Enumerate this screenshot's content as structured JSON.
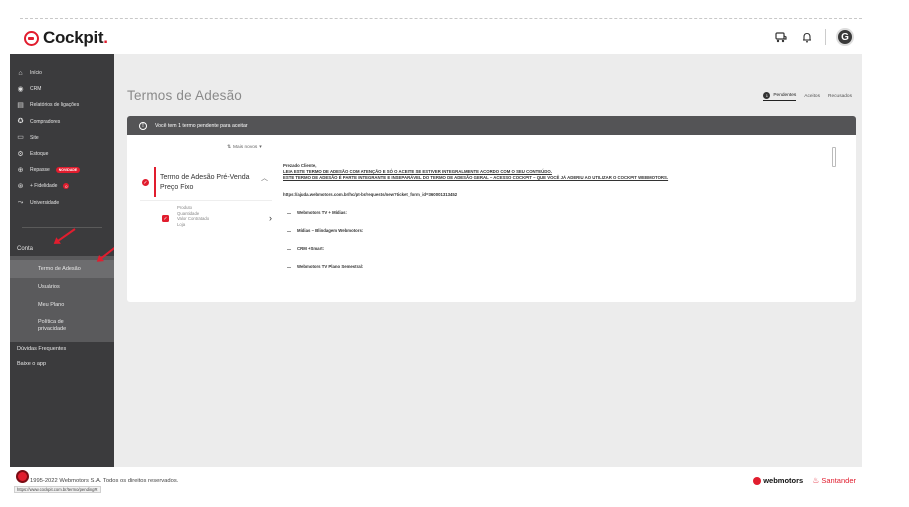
{
  "app": {
    "brand_name": "Cockpit",
    "brand_suffix": ".",
    "avatar_initial": "G"
  },
  "sidebar": {
    "items": [
      {
        "label": "Início",
        "icon": "home-icon"
      },
      {
        "label": "CRM",
        "icon": "crm-icon"
      },
      {
        "label": "Relatórios de ligações",
        "icon": "report-icon"
      },
      {
        "label": "Compradores",
        "icon": "buyers-icon"
      },
      {
        "label": "Site",
        "icon": "site-icon"
      },
      {
        "label": "Estoque",
        "icon": "stock-icon"
      },
      {
        "label": "Repasse",
        "icon": "repasse-icon",
        "badge": "NOVIDADE"
      },
      {
        "label": "+ Fidelidade",
        "icon": "loyalty-icon",
        "badge": "0"
      },
      {
        "label": "Universidade",
        "icon": "university-icon"
      }
    ],
    "conta_label": "Conta",
    "conta_items": [
      {
        "label": "Termo de Adesão"
      },
      {
        "label": "Usuários"
      },
      {
        "label": "Meu Plano"
      },
      {
        "label": "Política de privacidade"
      }
    ],
    "bottom_items": [
      {
        "label": "Dúvidas Frequentes"
      },
      {
        "label": "Baixe o app"
      }
    ]
  },
  "main": {
    "page_title": "Termos de Adesão",
    "tabs": [
      {
        "label": "Pendentes",
        "count": "1"
      },
      {
        "label": "Aceitos"
      },
      {
        "label": "Recusados"
      }
    ],
    "banner_text": "Você tem 1 termo pendente para aceitar",
    "sort_label": "Mais novos",
    "document": {
      "title": "Termo de Adesão Pré-Venda Preço Fixo",
      "sub_lines": [
        "Produto",
        "Quantidade",
        "Valor Contratado",
        "Loja"
      ]
    },
    "content": {
      "greeting": "Prezado Cliente,",
      "line1": "LEIA ESTE TERMO DE ADESÃO COM ATENÇÃO E SÓ O ACEITE SE ESTIVER INTEGRALMENTE ACORDO COM O SEU CONTEÚDO.",
      "line2": "ESTE TERMO DE ADESÃO É PARTE INTEGRANTE E INSEPARÁVEL DO TERMO DE ADESÃO GERAL – ACESSO COCKPIT – QUE VOCÊ JÁ ADERIU AO UTILIZAR O COCKPIT WEBMOTORS.",
      "url": "https://ajuda.webmotors.com.br/hc/pt-br/requests/new?ticket_form_id=360001313452",
      "items": [
        "Webmotors TV + Mídias:",
        "Mídias – Blindagem Webmotors:",
        "CRM +Smart:",
        "Webmotors TV Plano Semestral:"
      ]
    }
  },
  "footer": {
    "copyright": "1995-2022 Webmotors S.A. Todos os direitos reservados.",
    "status_url": "https://www.cockpit.com.br/termo/pendingR",
    "brand1": "webmotors",
    "brand2": "Santander"
  },
  "colors": {
    "accent": "#e11d2e",
    "sidebar_bg": "#3b3b3d",
    "banner_bg": "#545456"
  }
}
